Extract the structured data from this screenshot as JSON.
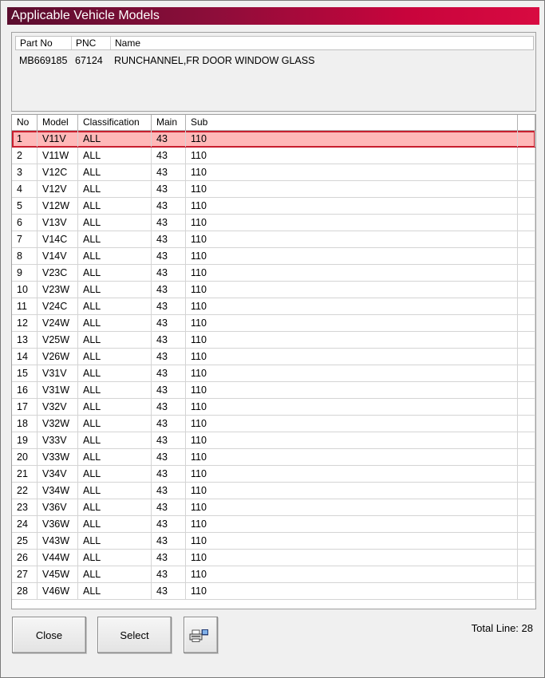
{
  "window": {
    "title": "Applicable Vehicle Models"
  },
  "part": {
    "headers": [
      "Part No",
      "PNC",
      "Name"
    ],
    "part_no": "MB669185",
    "pnc": "67124",
    "name": "RUNCHANNEL,FR DOOR WINDOW GLASS"
  },
  "grid": {
    "headers": [
      "No",
      "Model",
      "Classification",
      "Main",
      "Sub"
    ],
    "selected_index": 0,
    "rows": [
      [
        "1",
        "V11V",
        "ALL",
        "43",
        "110"
      ],
      [
        "2",
        "V11W",
        "ALL",
        "43",
        "110"
      ],
      [
        "3",
        "V12C",
        "ALL",
        "43",
        "110"
      ],
      [
        "4",
        "V12V",
        "ALL",
        "43",
        "110"
      ],
      [
        "5",
        "V12W",
        "ALL",
        "43",
        "110"
      ],
      [
        "6",
        "V13V",
        "ALL",
        "43",
        "110"
      ],
      [
        "7",
        "V14C",
        "ALL",
        "43",
        "110"
      ],
      [
        "8",
        "V14V",
        "ALL",
        "43",
        "110"
      ],
      [
        "9",
        "V23C",
        "ALL",
        "43",
        "110"
      ],
      [
        "10",
        "V23W",
        "ALL",
        "43",
        "110"
      ],
      [
        "11",
        "V24C",
        "ALL",
        "43",
        "110"
      ],
      [
        "12",
        "V24W",
        "ALL",
        "43",
        "110"
      ],
      [
        "13",
        "V25W",
        "ALL",
        "43",
        "110"
      ],
      [
        "14",
        "V26W",
        "ALL",
        "43",
        "110"
      ],
      [
        "15",
        "V31V",
        "ALL",
        "43",
        "110"
      ],
      [
        "16",
        "V31W",
        "ALL",
        "43",
        "110"
      ],
      [
        "17",
        "V32V",
        "ALL",
        "43",
        "110"
      ],
      [
        "18",
        "V32W",
        "ALL",
        "43",
        "110"
      ],
      [
        "19",
        "V33V",
        "ALL",
        "43",
        "110"
      ],
      [
        "20",
        "V33W",
        "ALL",
        "43",
        "110"
      ],
      [
        "21",
        "V34V",
        "ALL",
        "43",
        "110"
      ],
      [
        "22",
        "V34W",
        "ALL",
        "43",
        "110"
      ],
      [
        "23",
        "V36V",
        "ALL",
        "43",
        "110"
      ],
      [
        "24",
        "V36W",
        "ALL",
        "43",
        "110"
      ],
      [
        "25",
        "V43W",
        "ALL",
        "43",
        "110"
      ],
      [
        "26",
        "V44W",
        "ALL",
        "43",
        "110"
      ],
      [
        "27",
        "V45W",
        "ALL",
        "43",
        "110"
      ],
      [
        "28",
        "V46W",
        "ALL",
        "43",
        "110"
      ]
    ]
  },
  "buttons": {
    "close": "Close",
    "select": "Select",
    "print_icon": "printer-icon"
  },
  "footer": {
    "total_line": "Total Line: 28"
  },
  "colors": {
    "title_start": "#5a0d2e",
    "title_end": "#d80a41",
    "selected_row": "#ffb8b8",
    "selected_border": "#c81e2e"
  }
}
